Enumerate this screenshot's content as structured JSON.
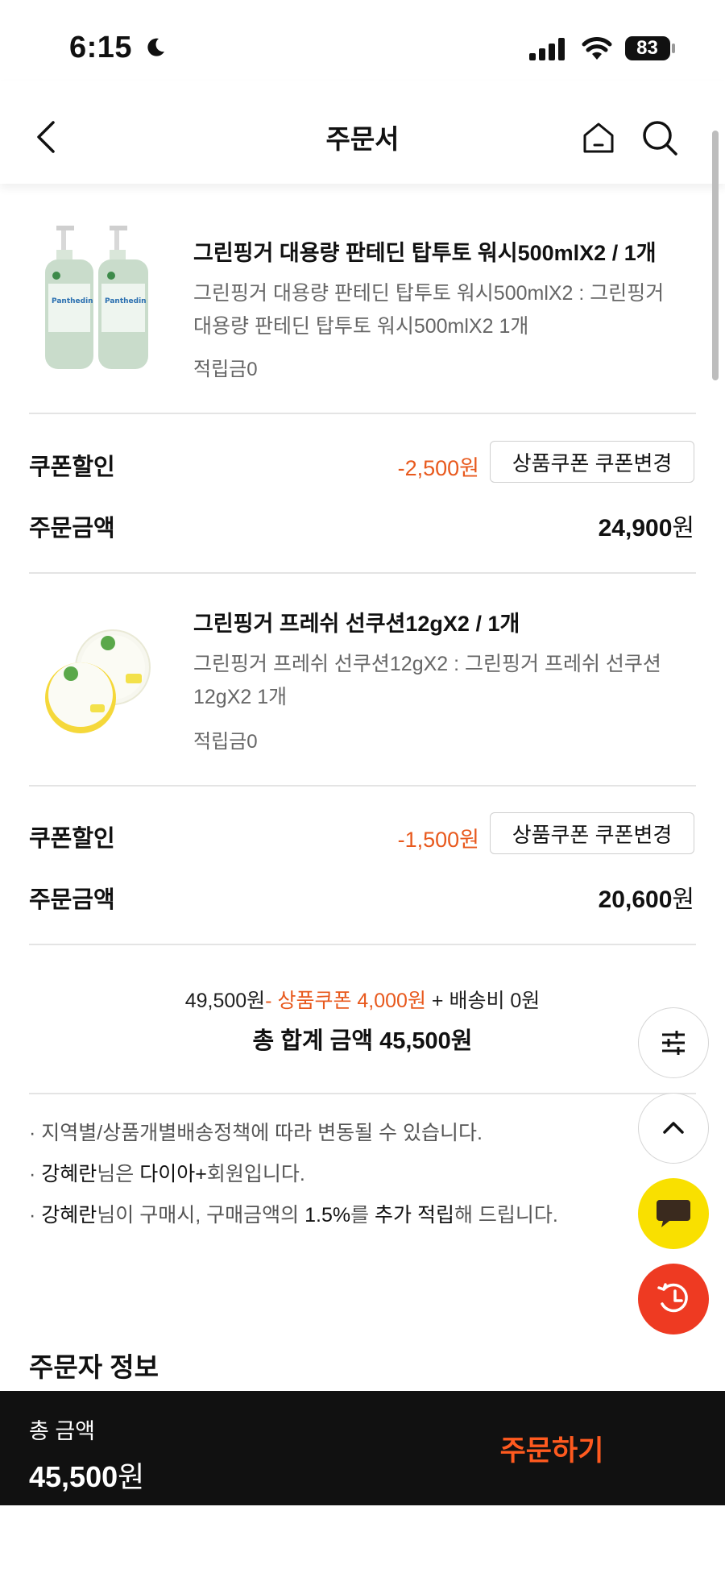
{
  "status_bar": {
    "time": "6:15",
    "battery": "83"
  },
  "header": {
    "title": "주문서"
  },
  "products": [
    {
      "title": "그린핑거 대용량 판테딘 탑투토 워시500mlX2 / 1개",
      "desc_line1": "그린핑거 대용량 판테딘 탑투토 워시500mlX2 : 그린핑거",
      "desc_line2": "대용량 판테딘 탑투토 워시500mlX2 1개",
      "points": "적립금0",
      "image_text": "Panthedin",
      "coupon_label": "쿠폰할인",
      "coupon_discount": "-2,500원",
      "coupon_button": "상품쿠폰 쿠폰변경",
      "amount_label": "주문금액",
      "amount_value": "24,900",
      "amount_unit": "원"
    },
    {
      "title": "그린핑거 프레쉬 선쿠션12gX2 / 1개",
      "desc_line1": "그린핑거 프레쉬 선쿠션12gX2 : 그린핑거 프레쉬 선쿠션",
      "desc_line2": "12gX2 1개",
      "points": "적립금0",
      "coupon_label": "쿠폰할인",
      "coupon_discount": "-1,500원",
      "coupon_button": "상품쿠폰 쿠폰변경",
      "amount_label": "주문금액",
      "amount_value": "20,600",
      "amount_unit": "원"
    }
  ],
  "summary": {
    "subtotal": "49,500원",
    "coupon_part": "- 상품쿠폰  4,000원",
    "shipping_part": " + 배송비  0원",
    "total_label": "총 합계 금액",
    "total_value": "45,500원"
  },
  "notes": {
    "n1": "· 지역별/상품개별배송정책에 따라 변동될 수 있습니다.",
    "n2_prefix": "· ",
    "n2_name": "강혜란",
    "n2_mid": "님은 ",
    "n2_grade": "다이아+",
    "n2_suffix": "회원입니다.",
    "n3_prefix": "· ",
    "n3_name": "강혜란",
    "n3_mid": "님이 구매시, 구매금액의 ",
    "n3_rate": "1.5%",
    "n3_mid2": "를 ",
    "n3_bold": "추가 적립",
    "n3_suffix": "해 드립니다."
  },
  "section": {
    "orderer_title": "주문자 정보"
  },
  "bottom_bar": {
    "total_label": "총 금액",
    "total_value": "45,500",
    "total_unit": "원",
    "order_button": "주문하기"
  },
  "colors": {
    "accent": "#e8591d",
    "chat": "#f9e000",
    "history": "#ee3a22"
  }
}
